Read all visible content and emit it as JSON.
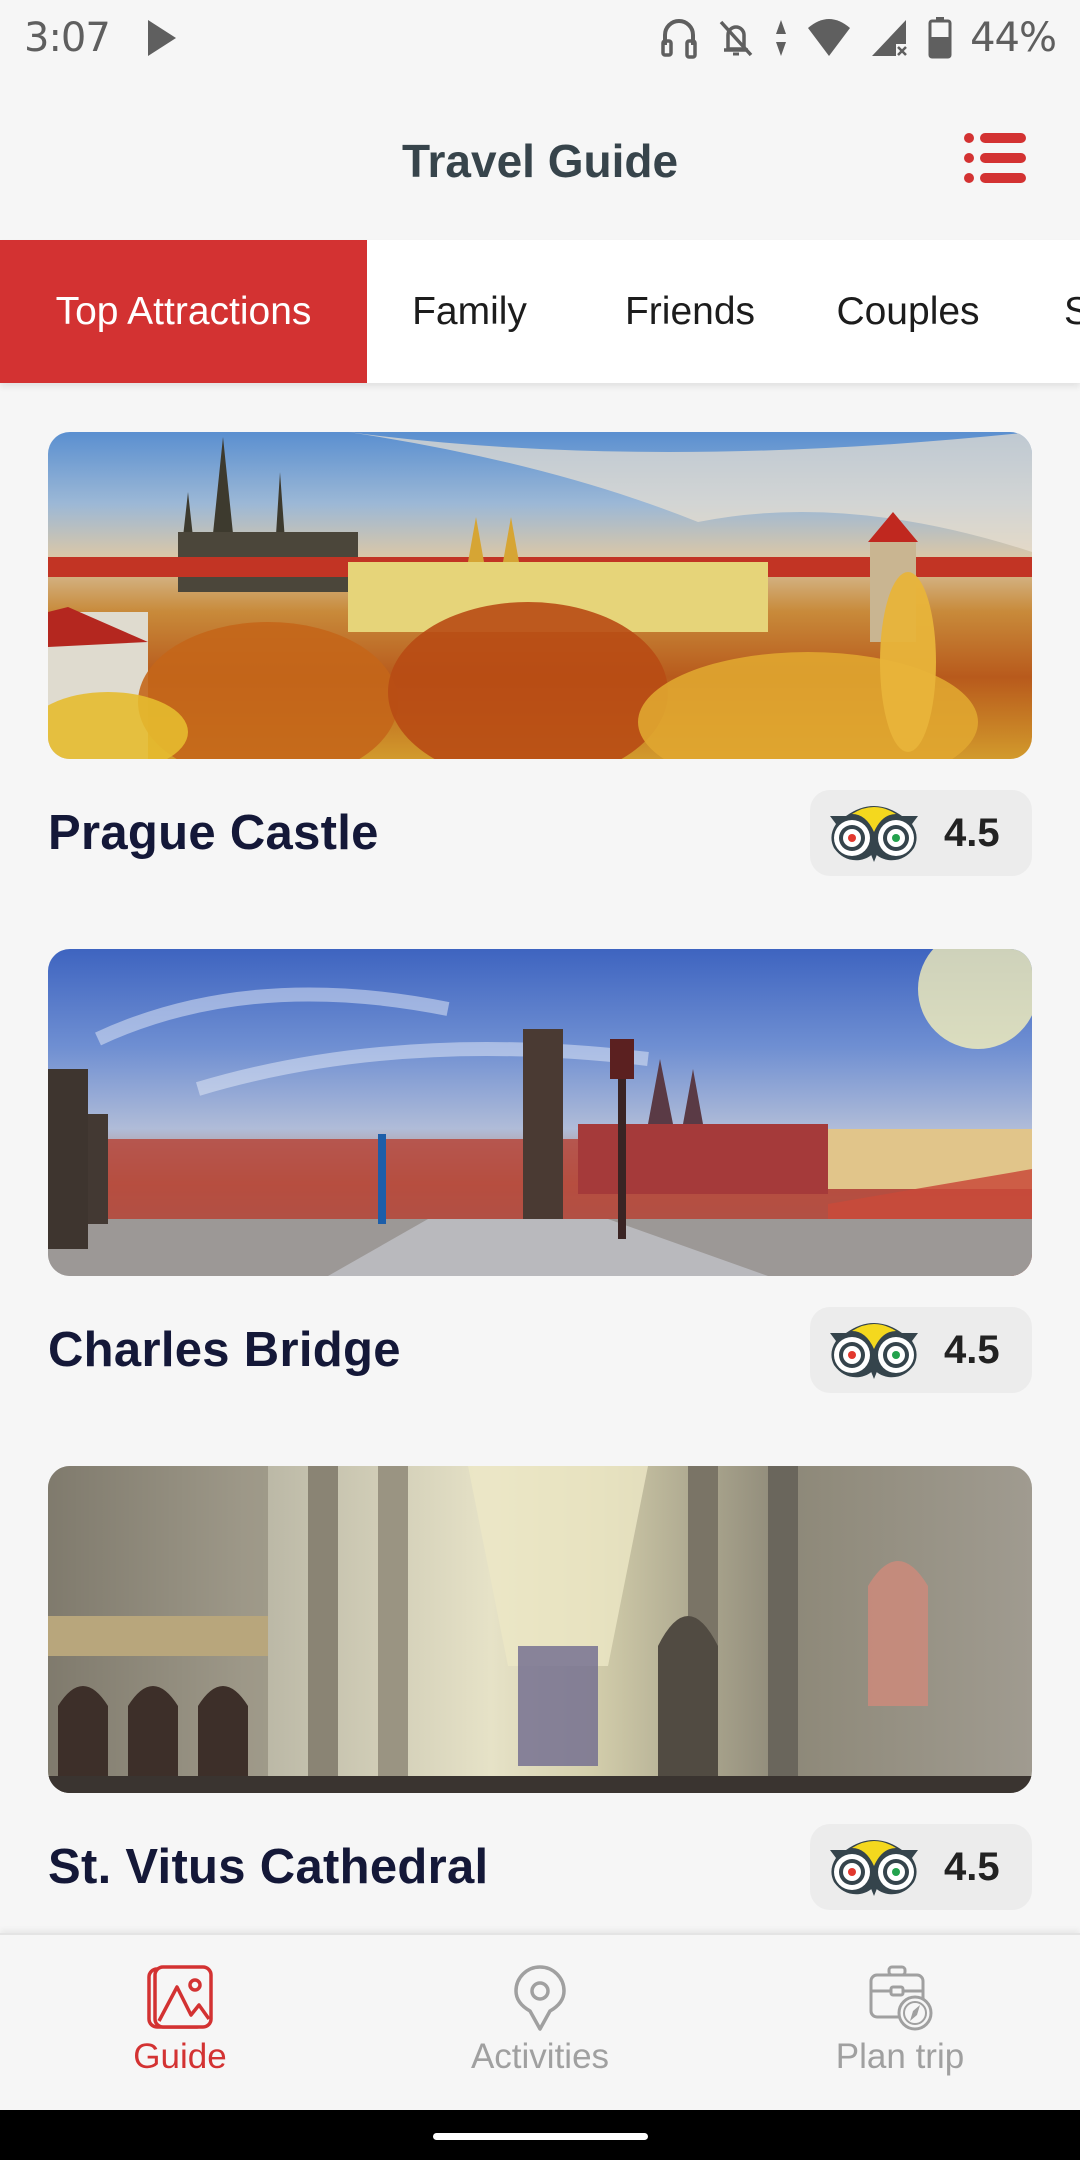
{
  "status_bar": {
    "time": "3:07",
    "battery_percent": "44%",
    "icons": [
      "play-icon",
      "headset-icon",
      "bell-off-icon",
      "data-arrows-icon",
      "wifi-icon",
      "cellular-no-data-icon",
      "battery-icon"
    ]
  },
  "header": {
    "title": "Travel Guide",
    "menu_icon": "list-menu-icon"
  },
  "tabs": [
    {
      "label": "Top Attractions",
      "active": true
    },
    {
      "label": "Family",
      "active": false
    },
    {
      "label": "Friends",
      "active": false
    },
    {
      "label": "Couples",
      "active": false
    },
    {
      "label": "S",
      "active": false
    }
  ],
  "attractions": [
    {
      "title": "Prague Castle",
      "rating": "4.5",
      "rating_icon": "tripadvisor-owl-icon",
      "image": "prague-castle-photo"
    },
    {
      "title": "Charles Bridge",
      "rating": "4.5",
      "rating_icon": "tripadvisor-owl-icon",
      "image": "charles-bridge-photo"
    },
    {
      "title": "St. Vitus Cathedral",
      "rating": "4.5",
      "rating_icon": "tripadvisor-owl-icon",
      "image": "st-vitus-cathedral-photo"
    }
  ],
  "bottom_nav": [
    {
      "label": "Guide",
      "icon": "gallery-image-icon",
      "active": true
    },
    {
      "label": "Activities",
      "icon": "map-pin-icon",
      "active": false
    },
    {
      "label": "Plan trip",
      "icon": "suitcase-compass-icon",
      "active": false
    }
  ],
  "colors": {
    "accent": "#d33232",
    "title_text": "#37444b",
    "card_title": "#141838",
    "inactive_nav": "#a0a0a0",
    "background": "#f6f6f6"
  }
}
